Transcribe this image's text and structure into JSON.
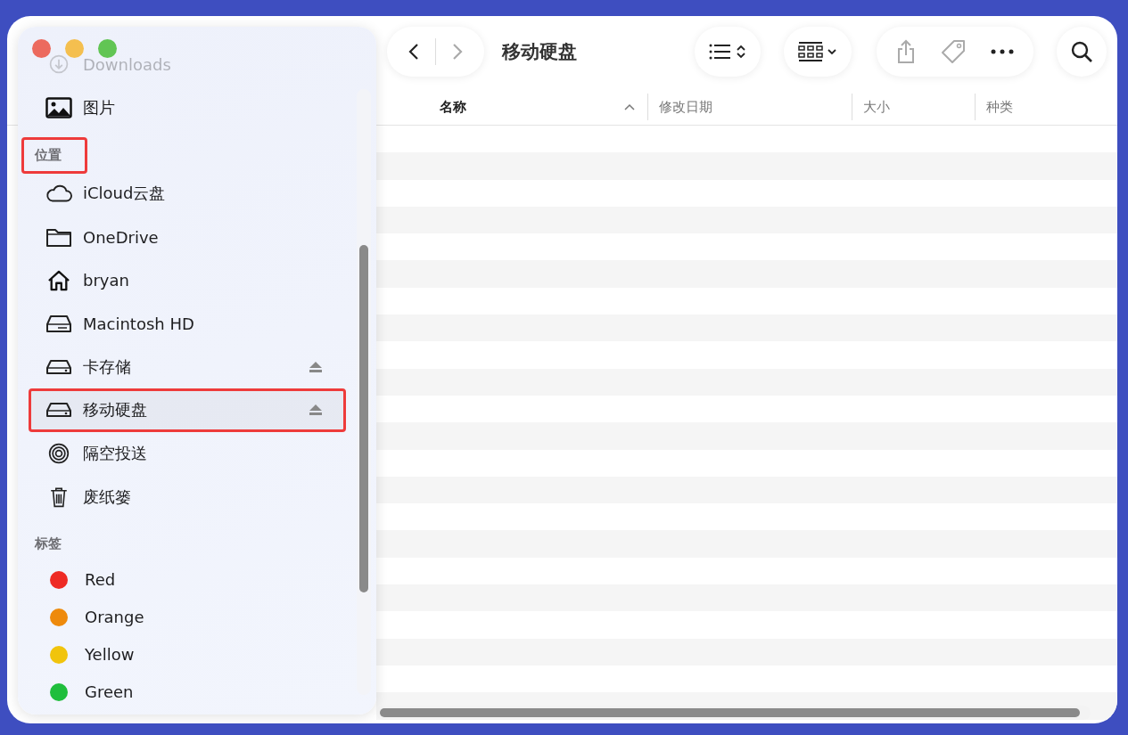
{
  "window": {
    "title": "移动硬盘"
  },
  "sidebar": {
    "items": [
      {
        "kind": "download",
        "label": "Downloads",
        "faded": true,
        "ejectable": false,
        "highlighted": false
      },
      {
        "kind": "pictures",
        "label": "图片",
        "faded": false,
        "ejectable": false,
        "highlighted": false
      }
    ],
    "sections": [
      {
        "title": "位置",
        "highlighted": true,
        "items": [
          {
            "kind": "cloud",
            "label": "iCloud云盘",
            "ejectable": false,
            "highlighted": false
          },
          {
            "kind": "folder",
            "label": "OneDrive",
            "ejectable": false,
            "highlighted": false
          },
          {
            "kind": "home",
            "label": "bryan",
            "ejectable": false,
            "highlighted": false
          },
          {
            "kind": "harddisk",
            "label": "Macintosh HD",
            "ejectable": false,
            "highlighted": false
          },
          {
            "kind": "drive",
            "label": "卡存储",
            "ejectable": true,
            "highlighted": false
          },
          {
            "kind": "drive",
            "label": "移动硬盘",
            "ejectable": true,
            "highlighted": true
          },
          {
            "kind": "airdrop",
            "label": "隔空投送",
            "ejectable": false,
            "highlighted": false
          },
          {
            "kind": "trash",
            "label": "废纸篓",
            "ejectable": false,
            "highlighted": false
          }
        ]
      },
      {
        "title": "标签",
        "highlighted": false,
        "items": [
          {
            "kind": "tag",
            "label": "Red",
            "color": "#ee2a24",
            "ejectable": false,
            "highlighted": false
          },
          {
            "kind": "tag",
            "label": "Orange",
            "color": "#ee8a0c",
            "ejectable": false,
            "highlighted": false
          },
          {
            "kind": "tag",
            "label": "Yellow",
            "color": "#f1c40c",
            "ejectable": false,
            "highlighted": false
          },
          {
            "kind": "tag",
            "label": "Green",
            "color": "#1fbe3c",
            "ejectable": false,
            "highlighted": false
          }
        ]
      }
    ]
  },
  "table": {
    "columns": [
      {
        "label": "名称",
        "sorted": true
      },
      {
        "label": "修改日期",
        "sorted": false
      },
      {
        "label": "大小",
        "sorted": false
      },
      {
        "label": "种类",
        "sorted": false
      }
    ]
  }
}
